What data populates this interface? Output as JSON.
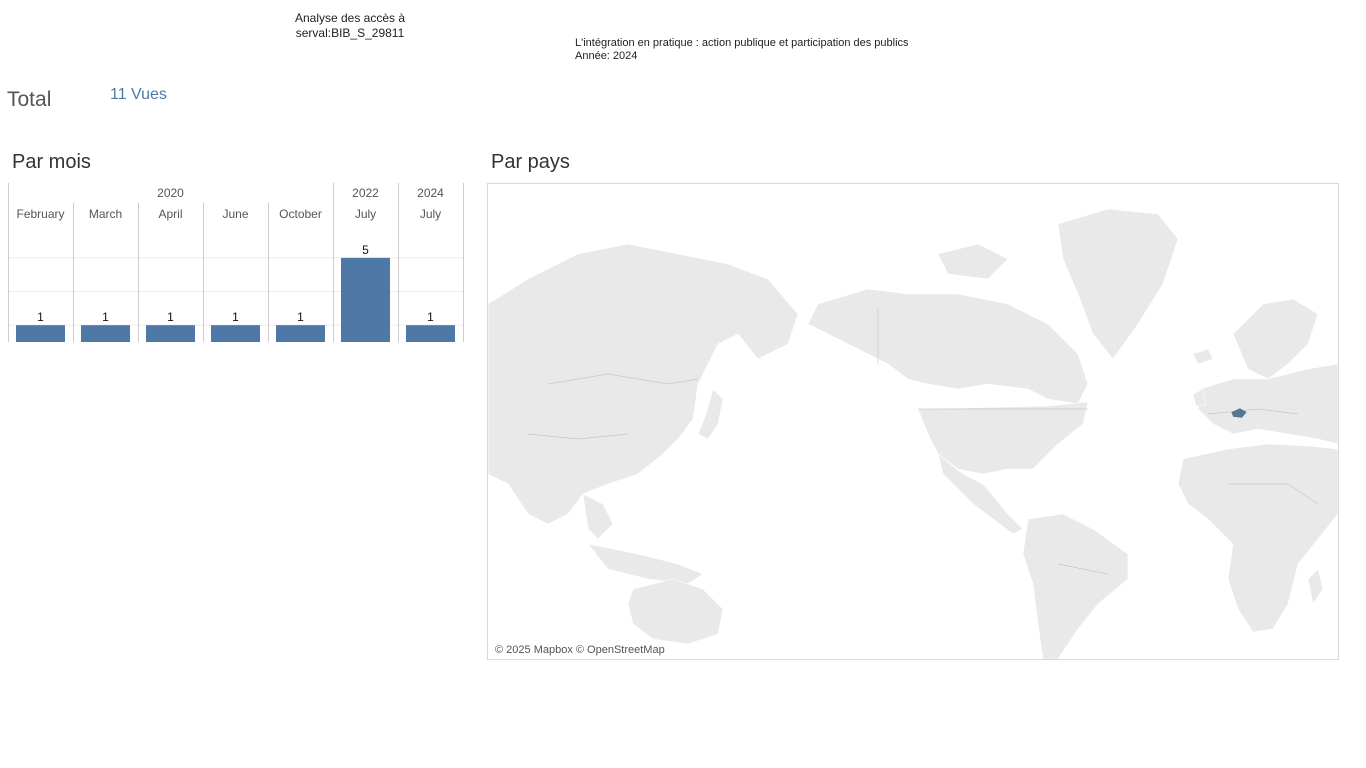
{
  "header": {
    "title_line1": "Analyse des accès à",
    "title_line2": "serval:BIB_S_29811",
    "publication_title": "L'intégration en pratique : action publique et participation des publics",
    "publication_year": "Année: 2024"
  },
  "total": {
    "label": "Total",
    "value": "11 Vues"
  },
  "sections": {
    "by_month": "Par mois",
    "by_country": "Par pays"
  },
  "chart_data": {
    "type": "bar",
    "title": "Par mois",
    "years": [
      {
        "label": "2020",
        "span": 5
      },
      {
        "label": "2022",
        "span": 1
      },
      {
        "label": "2024",
        "span": 1
      }
    ],
    "categories": [
      "February",
      "March",
      "April",
      "June",
      "October",
      "July",
      "July"
    ],
    "values": [
      1,
      1,
      1,
      1,
      1,
      5,
      1
    ],
    "ylim": [
      0,
      6
    ],
    "bar_color": "#4e79a7",
    "grid": true
  },
  "map": {
    "highlighted_country_color": "#5a7590",
    "land_color": "#e9e9e9",
    "attribution": "© 2025 Mapbox © OpenStreetMap"
  }
}
